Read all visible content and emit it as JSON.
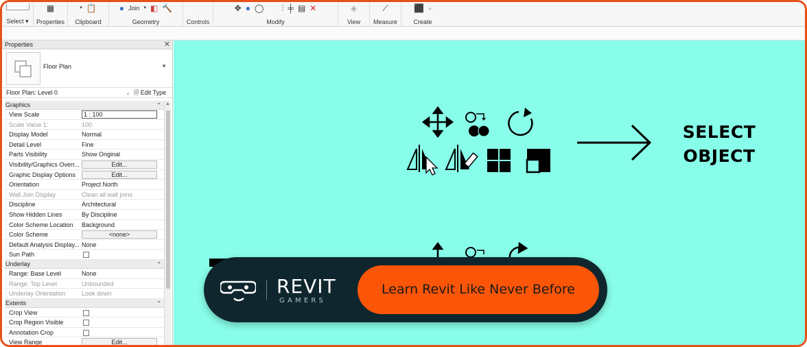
{
  "ribbon": {
    "groups": [
      {
        "label": "Select ▾"
      },
      {
        "label": "Properties"
      },
      {
        "label": "Clipboard"
      },
      {
        "label": "Geometry",
        "join_label": "Join"
      },
      {
        "label": "Controls"
      },
      {
        "label": "Modify"
      },
      {
        "label": "View"
      },
      {
        "label": "Measure"
      },
      {
        "label": "Create"
      }
    ]
  },
  "properties": {
    "title": "Properties",
    "type_name": "Floor Plan",
    "instance": "Floor Plan: Level 0",
    "edit_type": "Edit Type",
    "categories": [
      {
        "name": "Graphics",
        "rows": [
          {
            "key": "View Scale",
            "value": "1 : 100",
            "kind": "box"
          },
          {
            "key": "Scale Value    1:",
            "value": "100",
            "kind": "text",
            "dim": true
          },
          {
            "key": "Display Model",
            "value": "Normal",
            "kind": "text"
          },
          {
            "key": "Detail Level",
            "value": "Fine",
            "kind": "text"
          },
          {
            "key": "Parts Visibility",
            "value": "Show Original",
            "kind": "text"
          },
          {
            "key": "Visibility/Graphics Overr...",
            "value": "Edit...",
            "kind": "button"
          },
          {
            "key": "Graphic Display Options",
            "value": "Edit...",
            "kind": "button"
          },
          {
            "key": "Orientation",
            "value": "Project North",
            "kind": "text"
          },
          {
            "key": "Wall Join Display",
            "value": "Clean all wall joins",
            "kind": "text",
            "dim": true
          },
          {
            "key": "Discipline",
            "value": "Architectural",
            "kind": "text"
          },
          {
            "key": "Show Hidden Lines",
            "value": "By Discipline",
            "kind": "text"
          },
          {
            "key": "Color Scheme Location",
            "value": "Background",
            "kind": "text"
          },
          {
            "key": "Color Scheme",
            "value": "<none>",
            "kind": "button"
          },
          {
            "key": "Default Analysis Display...",
            "value": "None",
            "kind": "text"
          },
          {
            "key": "Sun Path",
            "value": "",
            "kind": "checkbox"
          }
        ]
      },
      {
        "name": "Underlay",
        "rows": [
          {
            "key": "Range: Base Level",
            "value": "None",
            "kind": "text"
          },
          {
            "key": "Range: Top Level",
            "value": "Unbounded",
            "kind": "text",
            "dim": true
          },
          {
            "key": "Underlay Orientation",
            "value": "Look down",
            "kind": "text",
            "dim": true
          }
        ]
      },
      {
        "name": "Extents",
        "rows": [
          {
            "key": "Crop View",
            "value": "",
            "kind": "checkbox"
          },
          {
            "key": "Crop Region Visible",
            "value": "",
            "kind": "checkbox"
          },
          {
            "key": "Annotation Crop",
            "value": "",
            "kind": "checkbox"
          },
          {
            "key": "View Range",
            "value": "Edit...",
            "kind": "button"
          }
        ]
      }
    ]
  },
  "canvas": {
    "heading_line1": "SELECT",
    "heading_line2": "OBJECT"
  },
  "banner": {
    "brand_main": "REVIT",
    "brand_sub": "GAMERS",
    "cta": "Learn Revit Like Never Before"
  },
  "colors": {
    "canvas_bg": "#88fde9",
    "banner_bg": "#10262e",
    "cta_bg": "#fb5607",
    "frame": "#e8501a"
  }
}
